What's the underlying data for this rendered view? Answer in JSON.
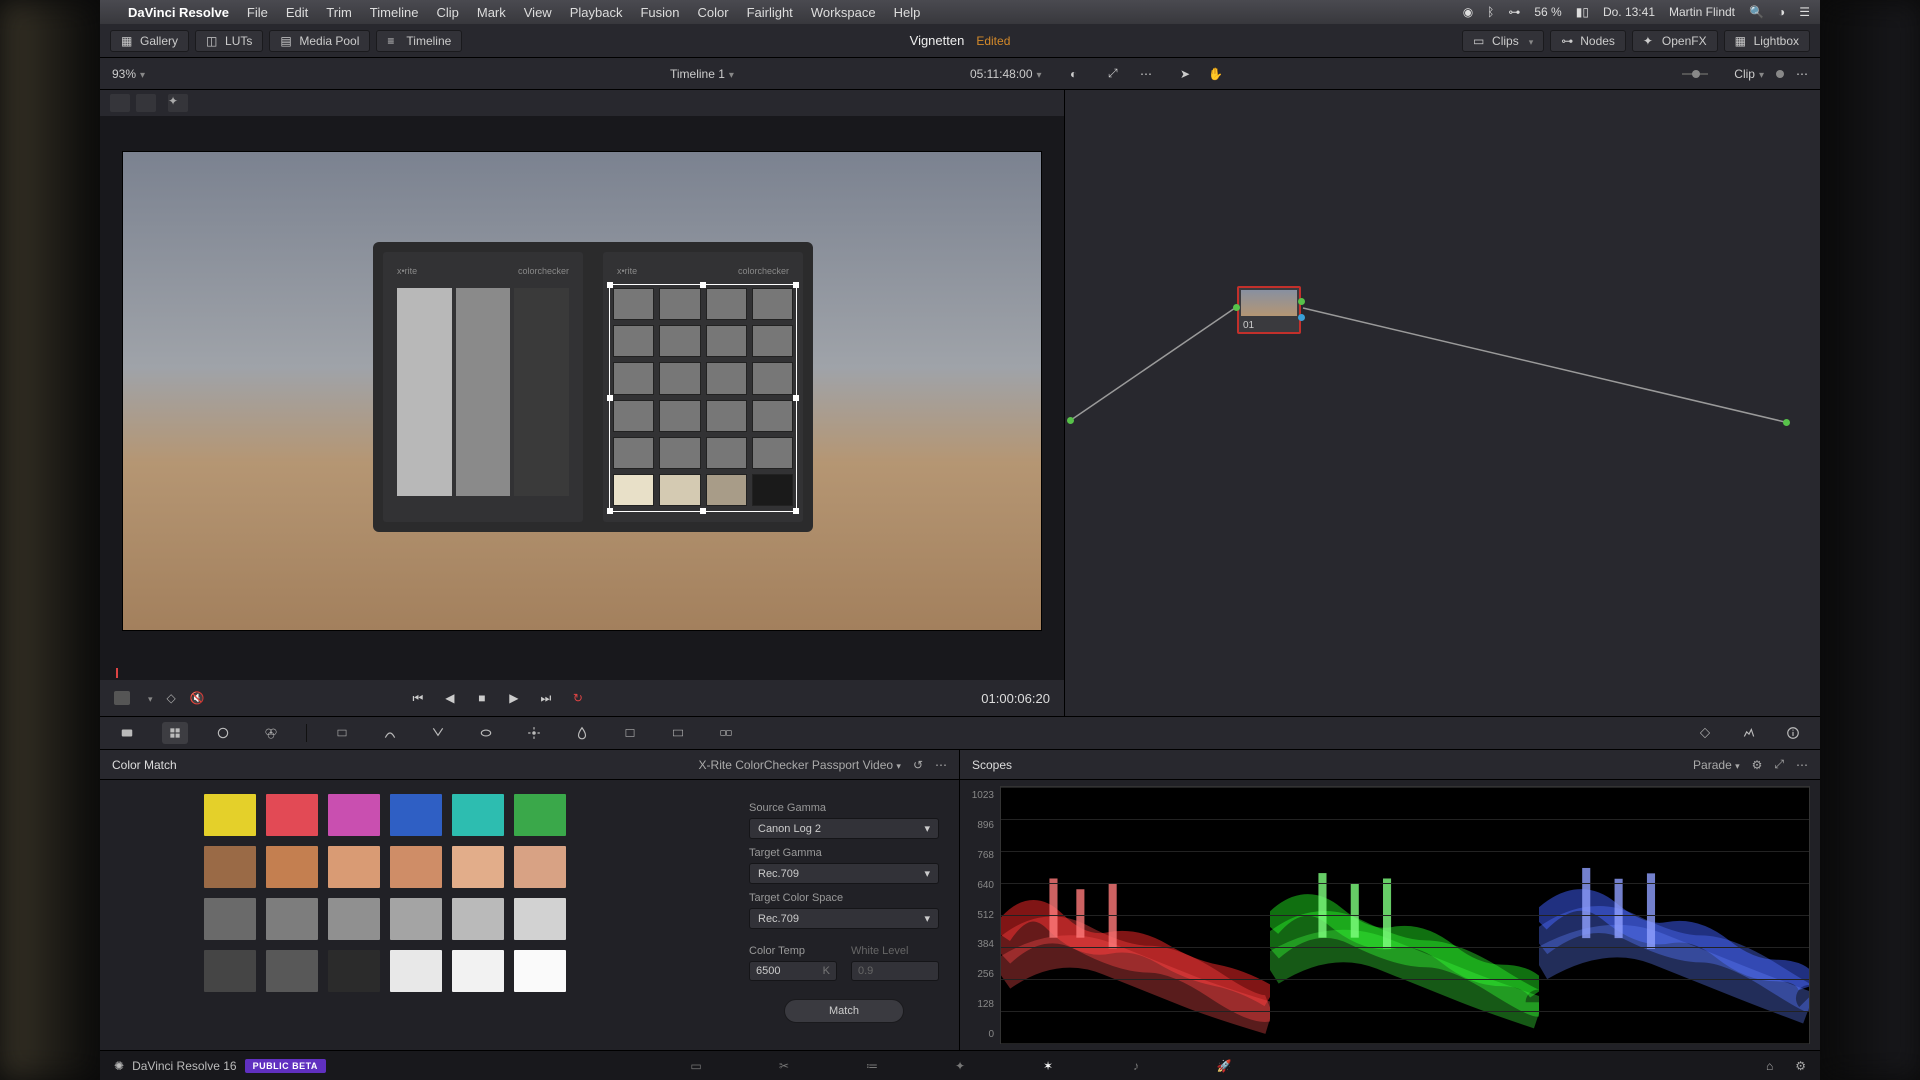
{
  "menubar": {
    "app_name": "DaVinci Resolve",
    "menus": [
      "File",
      "Edit",
      "Trim",
      "Timeline",
      "Clip",
      "Mark",
      "View",
      "Playback",
      "Fusion",
      "Color",
      "Fairlight",
      "Workspace",
      "Help"
    ],
    "battery": "56 %",
    "date": "Do. 13:41",
    "user": "Martin Flindt"
  },
  "topbar": {
    "gallery": "Gallery",
    "luts": "LUTs",
    "media_pool": "Media Pool",
    "timeline": "Timeline",
    "project": "Vignetten",
    "status": "Edited",
    "clips": "Clips",
    "nodes": "Nodes",
    "openfx": "OpenFX",
    "lightbox": "Lightbox"
  },
  "tlheader": {
    "zoom": "93%",
    "timeline_name": "Timeline 1",
    "source_tc": "05:11:48:00",
    "clip_label": "Clip"
  },
  "node": {
    "label": "01"
  },
  "transport": {
    "record_tc": "01:00:06:20"
  },
  "color_match": {
    "title": "Color Match",
    "chart_name": "X-Rite ColorChecker Passport Video",
    "source_gamma_label": "Source Gamma",
    "source_gamma": "Canon Log 2",
    "target_gamma_label": "Target Gamma",
    "target_gamma": "Rec.709",
    "target_cs_label": "Target Color Space",
    "target_cs": "Rec.709",
    "color_temp_label": "Color Temp",
    "white_level_label": "White Level",
    "color_temp": "6500",
    "color_temp_unit": "K",
    "white_level": "0.9",
    "match_btn": "Match",
    "swatches": [
      "#e4d02a",
      "#e24a55",
      "#c94fb0",
      "#2f5fc4",
      "#2dbdb0",
      "#3aa84a",
      "#9a6a46",
      "#c47f50",
      "#d99b74",
      "#cf8d67",
      "#e2ad8a",
      "#d8a284",
      "#6a6a6a",
      "#7d7d7d",
      "#909090",
      "#a4a4a4",
      "#bababa",
      "#d2d2d2",
      "#454545",
      "#585858",
      "#2b2b2b",
      "#e8e8e8",
      "#f2f2f2",
      "#fafafa"
    ]
  },
  "viewer_card": {
    "brand_l": "x•rite",
    "model_l": "colorchecker",
    "brand_r": "x•rite",
    "model_r": "colorchecker"
  },
  "scopes": {
    "title": "Scopes",
    "mode": "Parade",
    "scale": [
      "1023",
      "896",
      "768",
      "640",
      "512",
      "384",
      "256",
      "128",
      "0"
    ]
  },
  "bottombar": {
    "brand": "DaVinci Resolve 16",
    "beta": "PUBLIC BETA"
  }
}
